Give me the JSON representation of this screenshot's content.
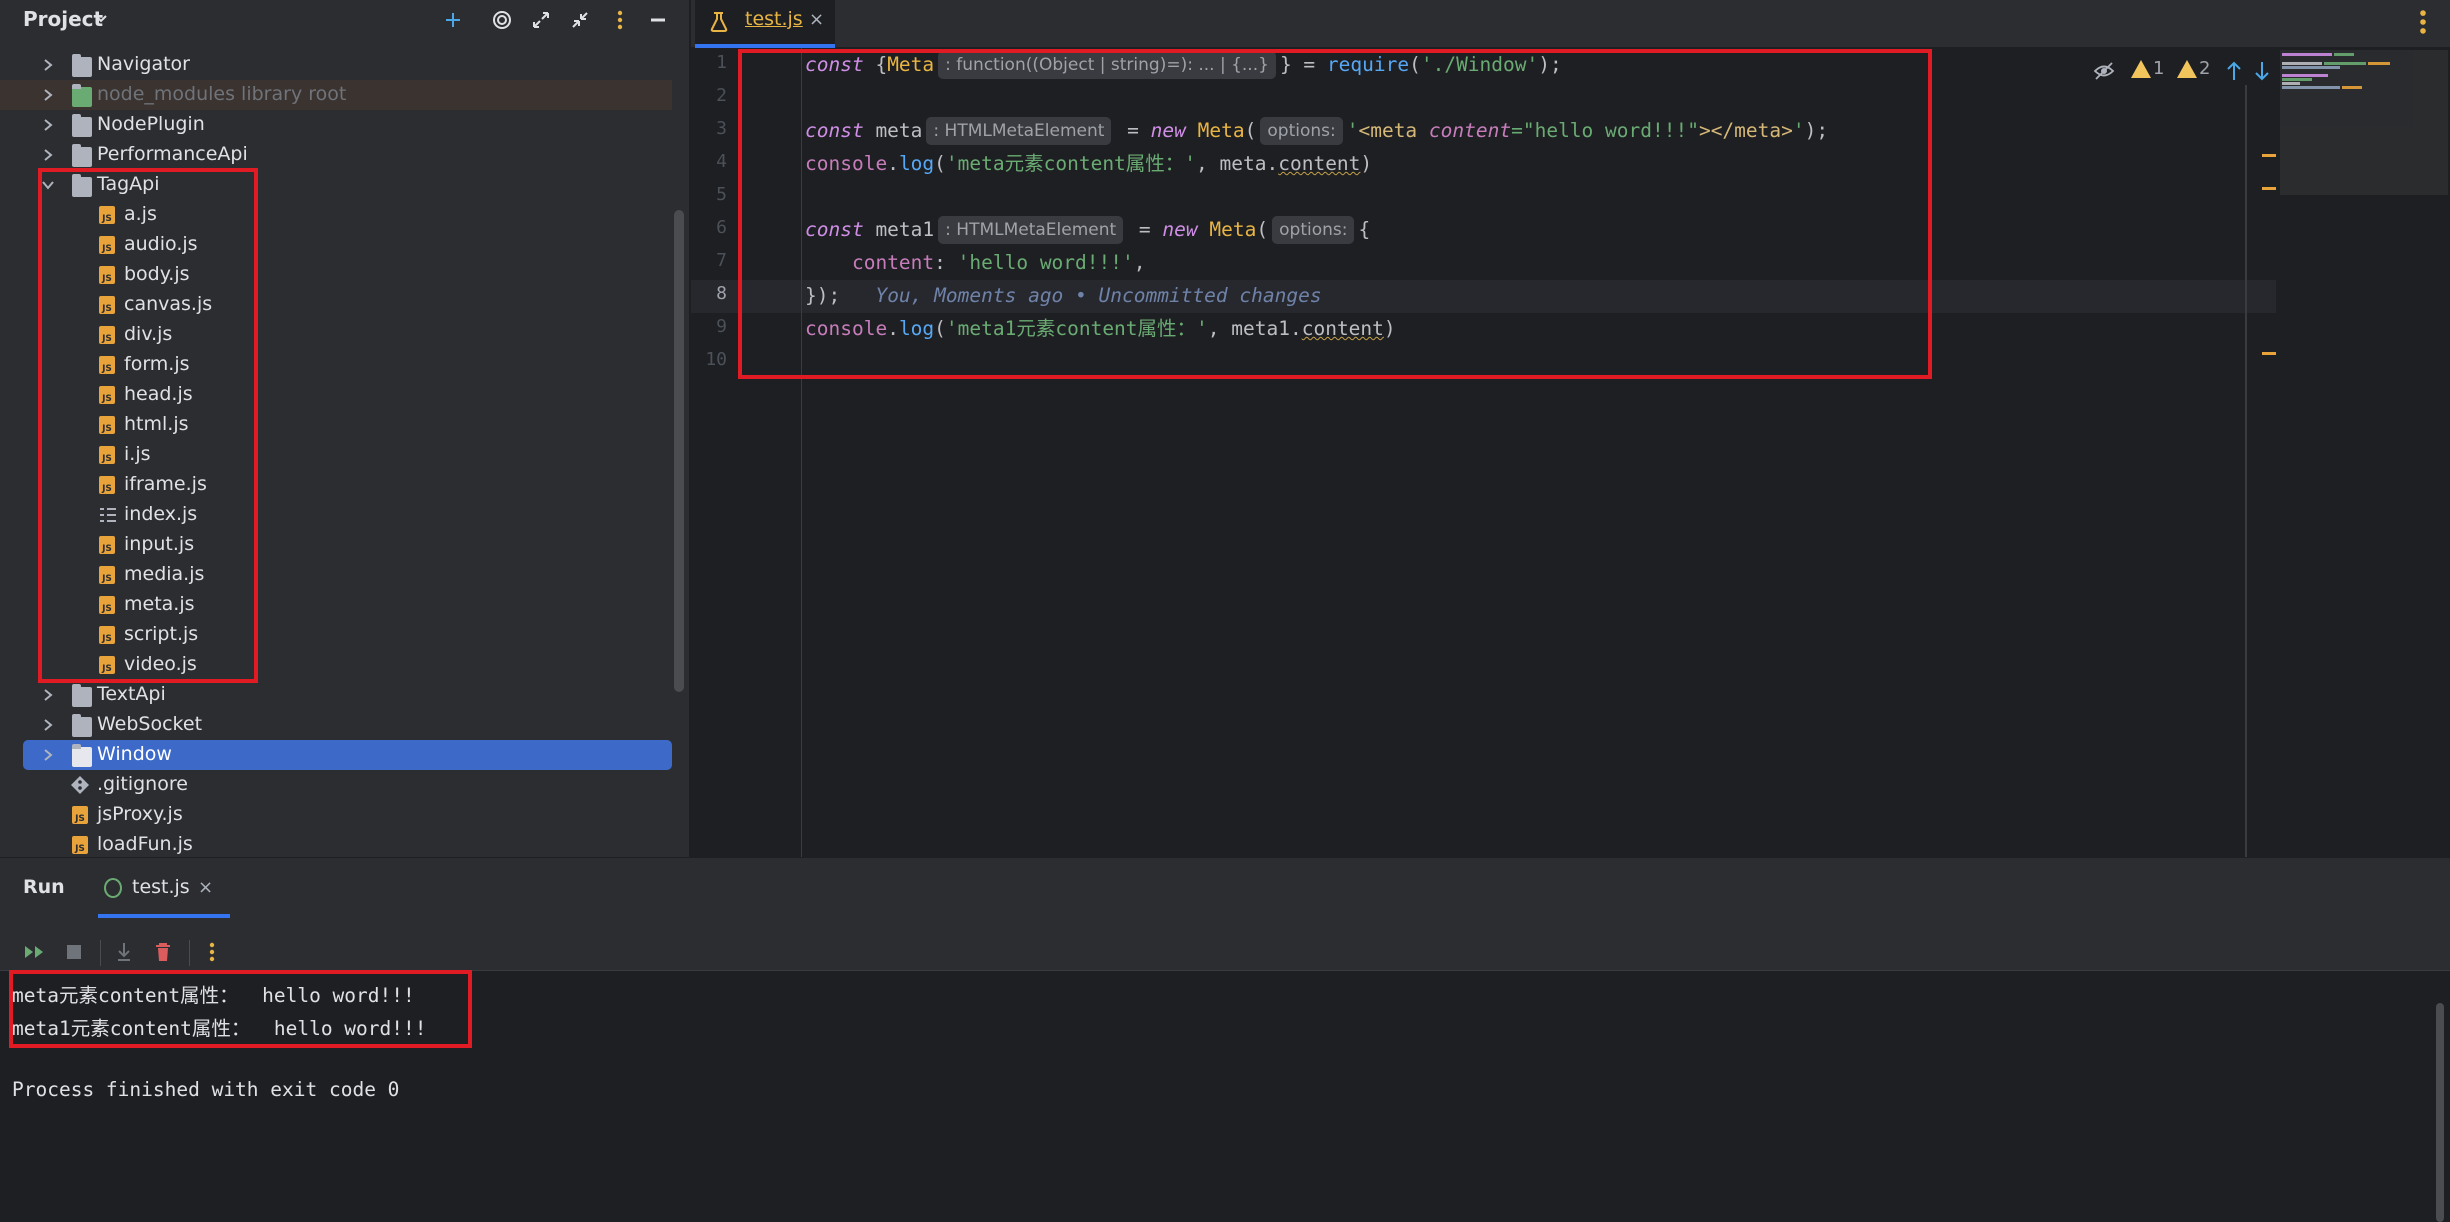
{
  "project": {
    "title": "Project",
    "tree": [
      {
        "label": "Navigator",
        "kind": "folder",
        "expanded": false,
        "depth": 1
      },
      {
        "label": "node_modules  library root",
        "kind": "library",
        "expanded": false,
        "depth": 1
      },
      {
        "label": "NodePlugin",
        "kind": "folder",
        "expanded": false,
        "depth": 1
      },
      {
        "label": "PerformanceApi",
        "kind": "folder",
        "expanded": false,
        "depth": 1
      },
      {
        "label": "TagApi",
        "kind": "folder",
        "expanded": true,
        "depth": 1
      },
      {
        "label": "a.js",
        "kind": "js",
        "depth": 2
      },
      {
        "label": "audio.js",
        "kind": "js",
        "depth": 2
      },
      {
        "label": "body.js",
        "kind": "js",
        "depth": 2
      },
      {
        "label": "canvas.js",
        "kind": "js",
        "depth": 2
      },
      {
        "label": "div.js",
        "kind": "js",
        "depth": 2
      },
      {
        "label": "form.js",
        "kind": "js",
        "depth": 2
      },
      {
        "label": "head.js",
        "kind": "js",
        "depth": 2
      },
      {
        "label": "html.js",
        "kind": "js",
        "depth": 2
      },
      {
        "label": "i.js",
        "kind": "js",
        "depth": 2
      },
      {
        "label": "iframe.js",
        "kind": "js",
        "depth": 2
      },
      {
        "label": "index.js",
        "kind": "index",
        "depth": 2
      },
      {
        "label": "input.js",
        "kind": "js",
        "depth": 2
      },
      {
        "label": "media.js",
        "kind": "js",
        "depth": 2
      },
      {
        "label": "meta.js",
        "kind": "js",
        "depth": 2
      },
      {
        "label": "script.js",
        "kind": "js",
        "depth": 2
      },
      {
        "label": "video.js",
        "kind": "js",
        "depth": 2
      },
      {
        "label": "TextApi",
        "kind": "folder",
        "expanded": false,
        "depth": 1
      },
      {
        "label": "WebSocket",
        "kind": "folder",
        "expanded": false,
        "depth": 1
      },
      {
        "label": "Window",
        "kind": "folder",
        "expanded": false,
        "depth": 1,
        "selected": true
      },
      {
        "label": ".gitignore",
        "kind": "git",
        "depth": 1
      },
      {
        "label": "jsProxy.js",
        "kind": "js",
        "depth": 1
      },
      {
        "label": "loadFun.js",
        "kind": "js",
        "depth": 1
      }
    ]
  },
  "editor": {
    "tab_label": "test.js",
    "tab_close": "×",
    "line_numbers": [
      "1",
      "2",
      "3",
      "4",
      "5",
      "6",
      "7",
      "8",
      "9",
      "10"
    ],
    "hints": {
      "meta_type": ": function((Object | string)=): ... | {...}",
      "meta_var_type": ": HTMLMetaElement",
      "options": "options:",
      "meta1_var_type": ": HTMLMetaElement"
    },
    "blame": "You, Moments ago • Uncommitted changes",
    "warnings": {
      "warn1": "1",
      "warn2": "2"
    }
  },
  "run": {
    "title": "Run",
    "tab_label": "test.js",
    "tab_close": "×",
    "console_lines": [
      "meta元素content属性：  hello word!!!",
      "meta1元素content属性：  hello word!!!",
      "",
      "Process finished with exit code 0"
    ]
  },
  "colors": {
    "accent": "#3574f0",
    "highlight_box": "#e01b24",
    "selection": "#3d6ac9",
    "warning": "#f2c55c"
  }
}
